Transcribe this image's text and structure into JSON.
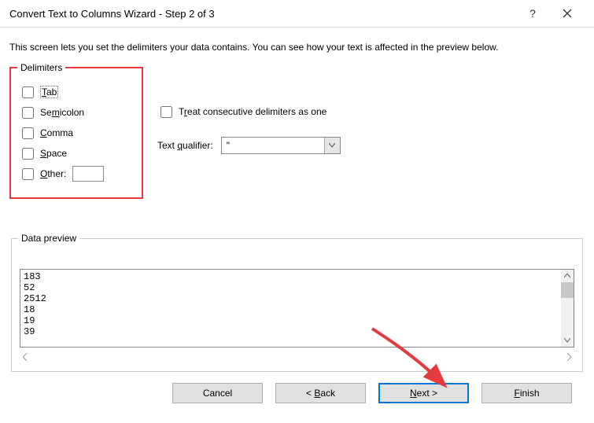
{
  "title": "Convert Text to Columns Wizard - Step 2 of 3",
  "intro": "This screen lets you set the delimiters your data contains.  You can see how your text is affected in the preview below.",
  "delimiters": {
    "group_label": "Delimiters",
    "tab": "Tab",
    "semicolon": "Semicolon",
    "comma": "Comma",
    "space": "Space",
    "other": "Other:"
  },
  "options": {
    "consecutive": "Treat consecutive delimiters as one",
    "qualifier_label": "Text qualifier:",
    "qualifier_value": "\""
  },
  "preview": {
    "group_label": "Data preview",
    "lines": [
      "183",
      "52",
      "2512",
      "18",
      "19",
      "39"
    ]
  },
  "buttons": {
    "cancel": "Cancel",
    "back": "< Back",
    "next": "Next >",
    "finish": "Finish"
  }
}
